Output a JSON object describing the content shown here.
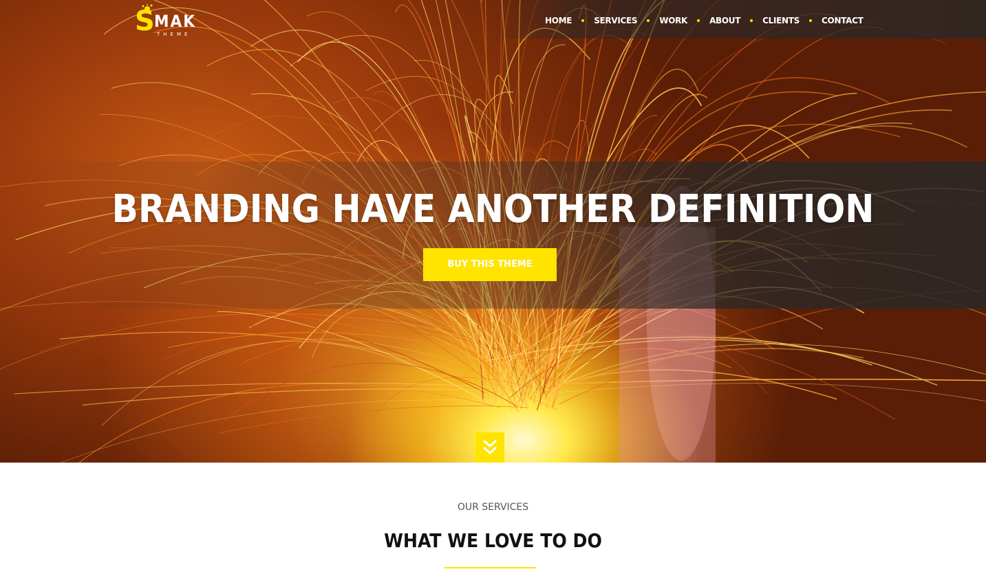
{
  "brand": {
    "logo_mark": "S",
    "logo_word": "MAK",
    "logo_sub": "THEME"
  },
  "nav": {
    "items": [
      {
        "label": "HOME"
      },
      {
        "label": "SERVICES"
      },
      {
        "label": "WORK"
      },
      {
        "label": "ABOUT"
      },
      {
        "label": "CLIENTS"
      },
      {
        "label": "CONTACT"
      }
    ]
  },
  "hero": {
    "headline": "BRANDING HAVE ANOTHER DEFINITION",
    "cta_label": "BUY THIS THEME",
    "scroll_icon": "double-chevron-down-icon"
  },
  "services": {
    "eyebrow": "OUR SERVICES",
    "title": "WHAT WE LOVE TO DO"
  },
  "colors": {
    "accent": "#ffe400",
    "text_dark": "#111111",
    "text_light": "#ffffff"
  }
}
